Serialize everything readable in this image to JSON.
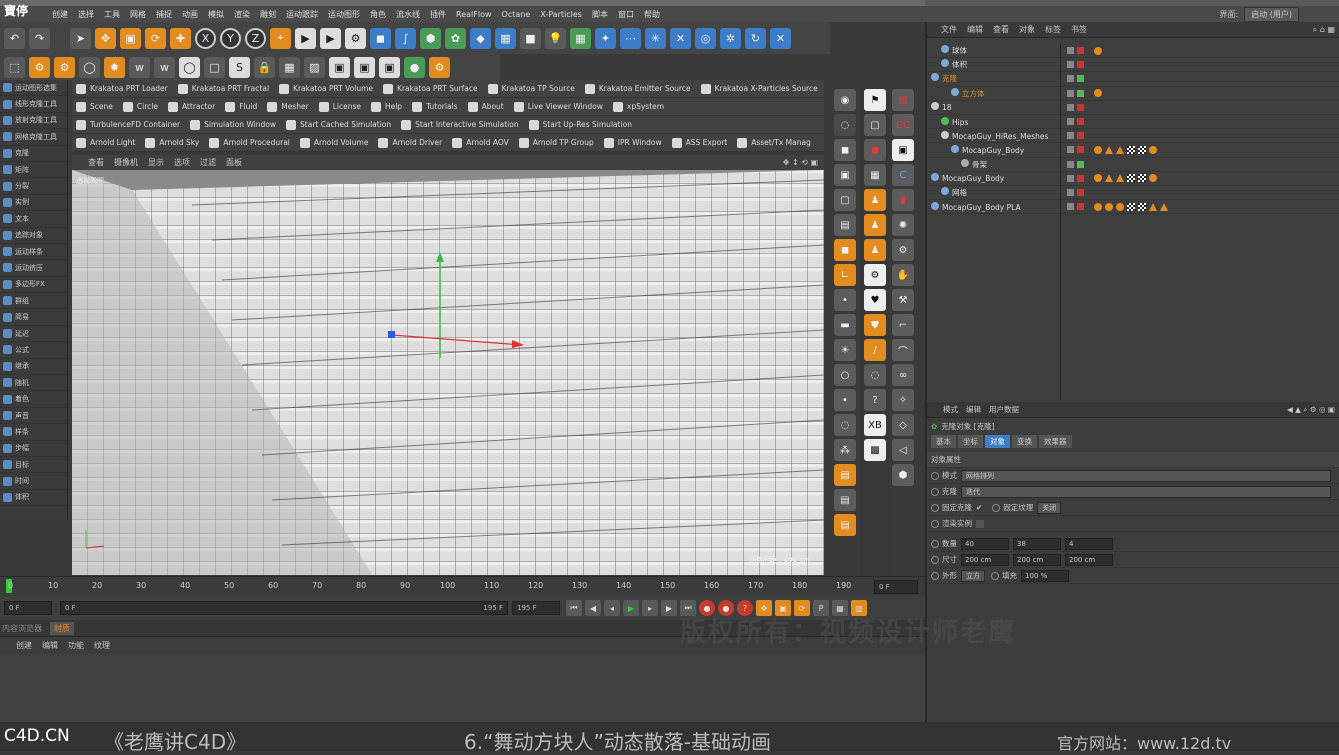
{
  "window": {
    "logo_text": "寶停"
  },
  "menu": {
    "items": [
      "创建",
      "选择",
      "工具",
      "网格",
      "捕捉",
      "动画",
      "模拟",
      "渲染",
      "雕刻",
      "运动跟踪",
      "运动图形",
      "角色",
      "流水线",
      "插件",
      "RealFlow",
      "Octane",
      "X-Particles",
      "脚本",
      "窗口",
      "帮助"
    ]
  },
  "layout_selector": {
    "label": "界面:",
    "value": "启动 (用户)"
  },
  "left_palette": {
    "items": [
      "运动图形选集",
      "线形克隆工具",
      "放射克隆工具",
      "网格克隆工具",
      "克隆",
      "矩阵",
      "分裂",
      "实例",
      "文本",
      "追踪对象",
      "运动样条",
      "运动挤压",
      "多边形FX",
      "群组",
      "简易",
      "延迟",
      "公式",
      "继承",
      "随机",
      "着色",
      "声音",
      "样条",
      "步幅",
      "目标",
      "时间",
      "体积"
    ]
  },
  "plugins": {
    "row1": [
      "Krakatoa PRT Loader",
      "Krakatoa PRT Fractal",
      "Krakatoa PRT Volume",
      "Krakatoa PRT Surface",
      "Krakatoa TP Source",
      "Krakatoa Emitter Source",
      "Krakatoa X-Particles Source"
    ],
    "row2": [
      "Scene",
      "Circle",
      "Attractor",
      "Fluid",
      "Mesher",
      "License",
      "Help",
      "Tutorials",
      "About",
      "Live Viewer Window",
      "xpSystem"
    ],
    "row3": [
      "TurbulenceFD Container",
      "Simulation Window",
      "Start Cached Simulation",
      "Start Interactive Simulation",
      "Start Up-Res Simulation"
    ],
    "row4": [
      "Arnold Light",
      "Arnold Sky",
      "Arnold Procedural",
      "Arnold Volume",
      "Arnold Driver",
      "Arnold AOV",
      "Arnold TP Group",
      "IPR Window",
      "ASS Export",
      "Asset/Tx Manag"
    ]
  },
  "viewport": {
    "menu": [
      "查看",
      "摄像机",
      "显示",
      "选项",
      "过滤",
      "面板"
    ],
    "label": "透视视图",
    "grid_spacing": "网格间距 : 100 cm"
  },
  "timeline": {
    "ticks": [
      "0",
      "10",
      "20",
      "30",
      "40",
      "50",
      "60",
      "70",
      "80",
      "90",
      "100",
      "110",
      "120",
      "130",
      "140",
      "150",
      "160",
      "170",
      "180",
      "190"
    ],
    "current_frame": "0 F"
  },
  "playback": {
    "start": "0 F",
    "range_start": "0 F",
    "range_end": "195 F",
    "end": "195 F"
  },
  "material": {
    "tabs": [
      "内容浏览器",
      "材质"
    ],
    "menu": [
      "创建",
      "编辑",
      "功能",
      "纹理"
    ]
  },
  "objects": {
    "menu": [
      "文件",
      "编辑",
      "查看",
      "对象",
      "标签",
      "书签"
    ],
    "rows": [
      {
        "name": "球体",
        "indent": 1
      },
      {
        "name": "体积",
        "indent": 1
      },
      {
        "name": "克隆",
        "indent": 0
      },
      {
        "name": "立方体",
        "indent": 2
      },
      {
        "name": "18",
        "indent": 0
      },
      {
        "name": "Hips",
        "indent": 1
      },
      {
        "name": "MocapGuy_HiRes_Meshes",
        "indent": 1
      },
      {
        "name": "MocapGuy_Body",
        "indent": 2
      },
      {
        "name": "骨架",
        "indent": 3
      },
      {
        "name": "MocapGuy_Body",
        "indent": 0
      },
      {
        "name": "网格",
        "indent": 1
      },
      {
        "name": "MocapGuy_Body PLA",
        "indent": 0
      }
    ]
  },
  "attributes": {
    "menu": [
      "模式",
      "编辑",
      "用户数据"
    ],
    "title": "克隆对象 [克隆]",
    "tabs": [
      "基本",
      "坐标",
      "对象",
      "变换",
      "效果器"
    ],
    "section": "对象属性",
    "mode_label": "模式",
    "mode_value": "网格排列",
    "clone_label": "克隆",
    "clone_value": "迭代",
    "fix_clone_label": "固定克隆",
    "fix_texture_label": "固定纹理",
    "fix_texture_value": "关闭",
    "render_instances_label": "渲染实例",
    "count_label": "数量",
    "count": [
      "40",
      "38",
      "4"
    ],
    "size_label": "尺寸",
    "size": [
      "200 cm",
      "200 cm",
      "200 cm"
    ],
    "shape_label": "外形",
    "shape_value": "立方",
    "fill_label": "填充",
    "fill_value": "100 %"
  },
  "watermark": "版权所有：视频设计师老鹰",
  "footer": {
    "left": "C4D.CN",
    "center": "《老鹰讲C4D》",
    "title": "6.“舞动方块人”动态散落-基础动画",
    "site": "官方网站：www.12d.tv"
  }
}
